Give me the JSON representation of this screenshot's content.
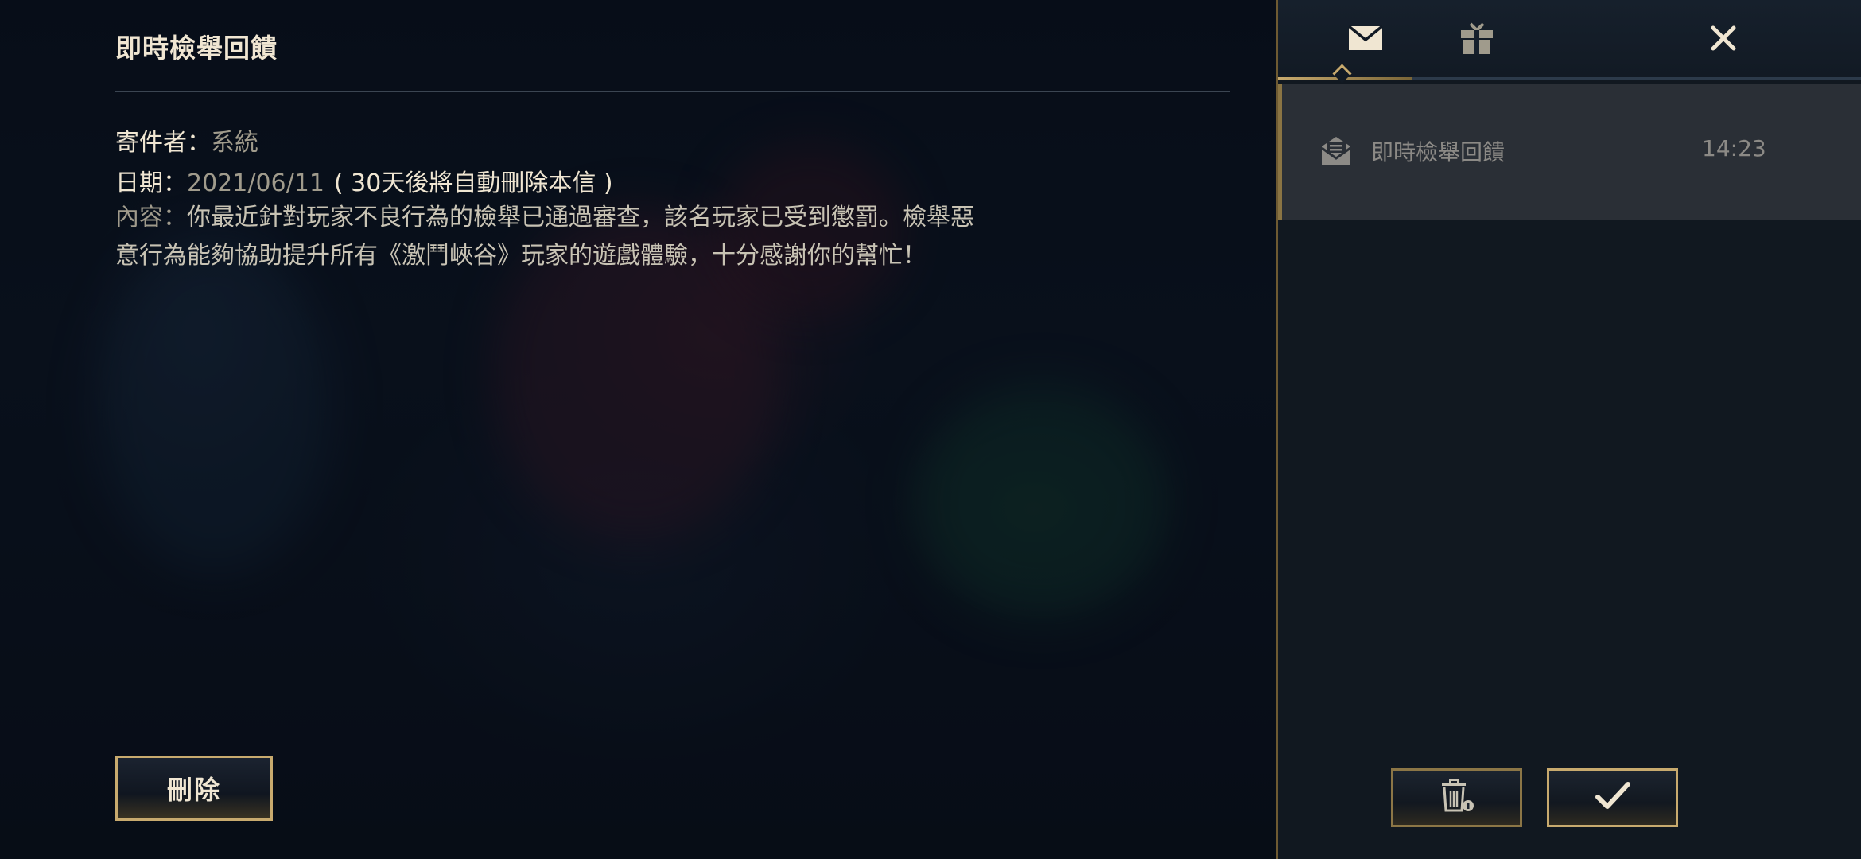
{
  "mail_detail": {
    "title": "即時檢舉回饋",
    "sender_label": "寄件者：",
    "sender_value": "系統",
    "date_label": "日期：",
    "date_value": "2021/06/11",
    "date_note": "( 30天後將自動刪除本信 )",
    "content_label": "內容：",
    "content_text": "你最近針對玩家不良行為的檢舉已通過審查，該名玩家已受到懲罰。檢舉惡意行為能夠協助提升所有《激鬥峽谷》玩家的遊戲體驗，十分感謝你的幫忙！",
    "delete_label": "刪除"
  },
  "mail_panel": {
    "tabs": [
      {
        "icon": "envelope-icon",
        "active": true
      },
      {
        "icon": "gift-icon",
        "active": false
      }
    ],
    "close_icon": "close-icon",
    "items": [
      {
        "icon": "open-envelope-icon",
        "subject": "即時檢舉回饋",
        "time": "14:23",
        "selected": true
      }
    ],
    "footer": {
      "trash_icon": "trash-icon",
      "confirm_icon": "checkmark-icon"
    }
  },
  "colors": {
    "gold": "#c8aa6e",
    "panel_bg": "#111820",
    "text_light": "#f0e6d2",
    "text_muted": "#a09b8c"
  }
}
